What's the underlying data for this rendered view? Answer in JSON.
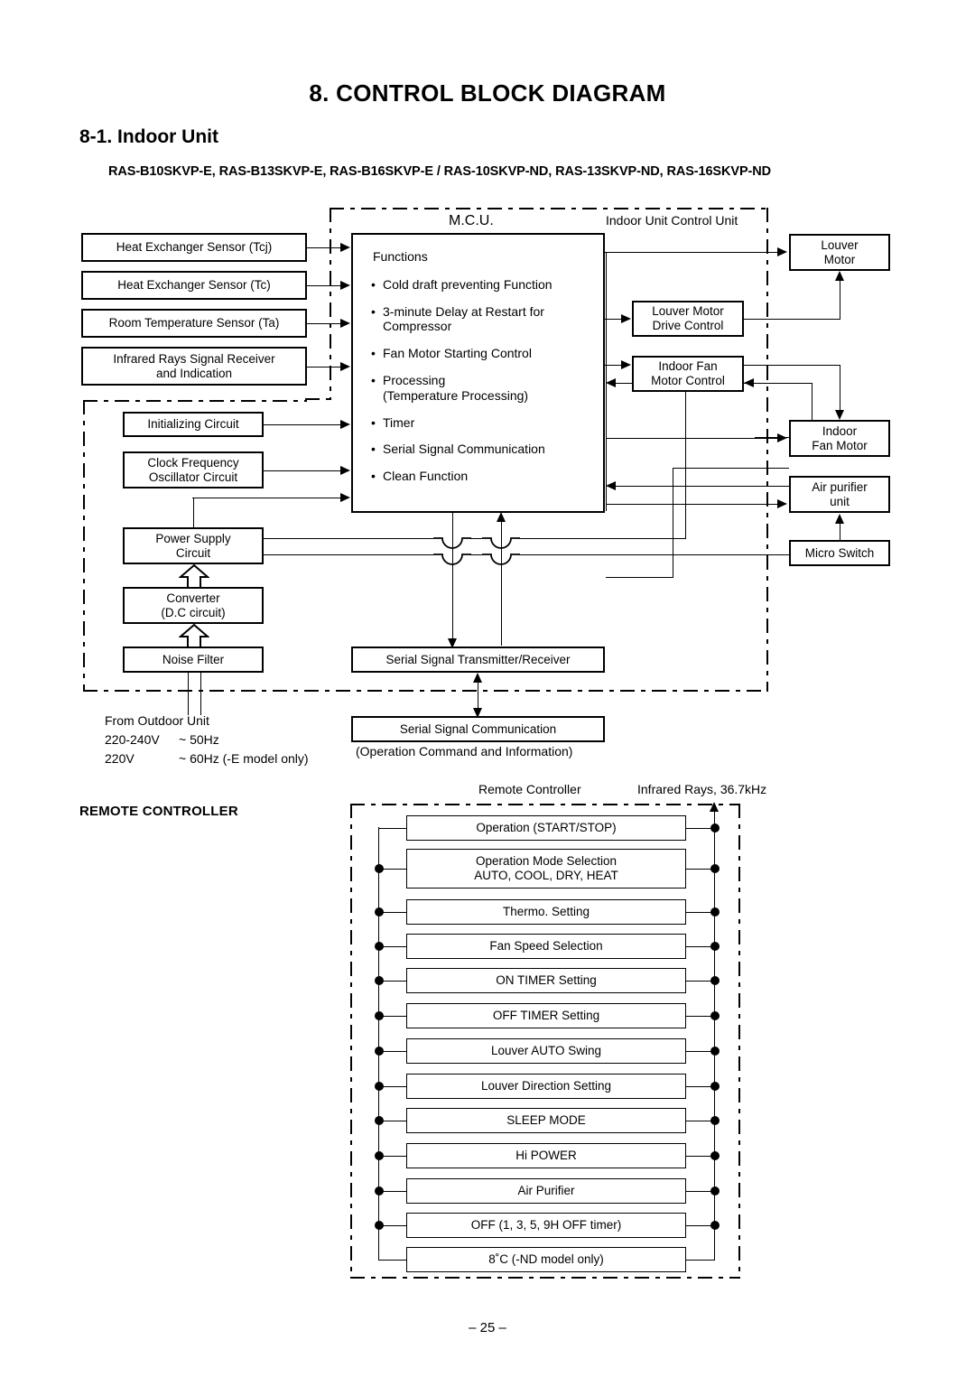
{
  "page": {
    "title": "8.  CONTROL BLOCK DIAGRAM",
    "section": "8-1. Indoor Unit",
    "models": "RAS-B10SKVP-E, RAS-B13SKVP-E, RAS-B16SKVP-E / RAS-10SKVP-ND, RAS-13SKVP-ND, RAS-16SKVP-ND",
    "footer": "– 25 –"
  },
  "labels": {
    "mcu": "M.C.U.",
    "indoor_unit_control_unit": "Indoor Unit Control Unit",
    "remote_controller": "Remote Controller",
    "infrared_rays": "Infrared Rays, 36.7kHz",
    "remote_controller_heading": "REMOTE CONTROLLER"
  },
  "sensors": [
    {
      "label": "Heat Exchanger Sensor (Tcj)"
    },
    {
      "label": "Heat Exchanger Sensor (Tc)"
    },
    {
      "label": "Room Temperature Sensor (Ta)"
    },
    {
      "label": "Infrared Rays Signal Receiver\nand Indication"
    }
  ],
  "mcu": {
    "functions_heading": "Functions",
    "functions": [
      {
        "text": "Cold draft preventing Function",
        "sub": ""
      },
      {
        "text": "3-minute Delay at Restart for",
        "sub": "Compressor"
      },
      {
        "text": "Fan Motor Starting Control",
        "sub": ""
      },
      {
        "text": "Processing",
        "sub": "(Temperature Processing)"
      },
      {
        "text": "Timer",
        "sub": ""
      },
      {
        "text": "Serial Signal Communication",
        "sub": ""
      },
      {
        "text": "Clean Function",
        "sub": ""
      }
    ]
  },
  "left_blocks": [
    {
      "label": "Initializing Circuit"
    },
    {
      "label": "Clock Frequency\nOscillator Circuit"
    },
    {
      "label": "Power Supply\nCircuit"
    },
    {
      "label": "Converter\n(D.C circuit)"
    },
    {
      "label": "Noise Filter"
    }
  ],
  "control_blocks": [
    {
      "label": "Louver Motor\nDrive Control"
    },
    {
      "label": "Indoor Fan\nMotor Control"
    }
  ],
  "output_blocks": [
    {
      "label": "Louver\nMotor"
    },
    {
      "label": "Indoor\nFan Motor"
    },
    {
      "label": "Air purifier\nunit"
    },
    {
      "label": "Micro Switch"
    }
  ],
  "serial": {
    "transmitter": "Serial Signal Transmitter/Receiver",
    "communication": "Serial Signal Communication",
    "communication_note": "(Operation Command and Information)"
  },
  "power_source": {
    "line1": "From Outdoor Unit",
    "line2_a": "220-240V",
    "line2_b": "~ 50Hz",
    "line3_a": "220V",
    "line3_b": "~ 60Hz (-E model only)"
  },
  "remote_functions": [
    {
      "label": "Operation (START/STOP)",
      "sub": ""
    },
    {
      "label": "Operation Mode Selection",
      "sub": "AUTO, COOL, DRY, HEAT"
    },
    {
      "label": "Thermo. Setting",
      "sub": ""
    },
    {
      "label": "Fan Speed Selection",
      "sub": ""
    },
    {
      "label": "ON TIMER Setting",
      "sub": ""
    },
    {
      "label": "OFF TIMER Setting",
      "sub": ""
    },
    {
      "label": "Louver AUTO Swing",
      "sub": ""
    },
    {
      "label": "Louver Direction Setting",
      "sub": ""
    },
    {
      "label": "SLEEP MODE",
      "sub": ""
    },
    {
      "label": "Hi POWER",
      "sub": ""
    },
    {
      "label": "Air Purifier",
      "sub": ""
    },
    {
      "label": "OFF (1, 3, 5, 9H OFF timer)",
      "sub": ""
    },
    {
      "label": "8˚C (-ND model only)",
      "sub": ""
    }
  ],
  "colors": {
    "ink": "#000000",
    "paper": "#ffffff"
  }
}
